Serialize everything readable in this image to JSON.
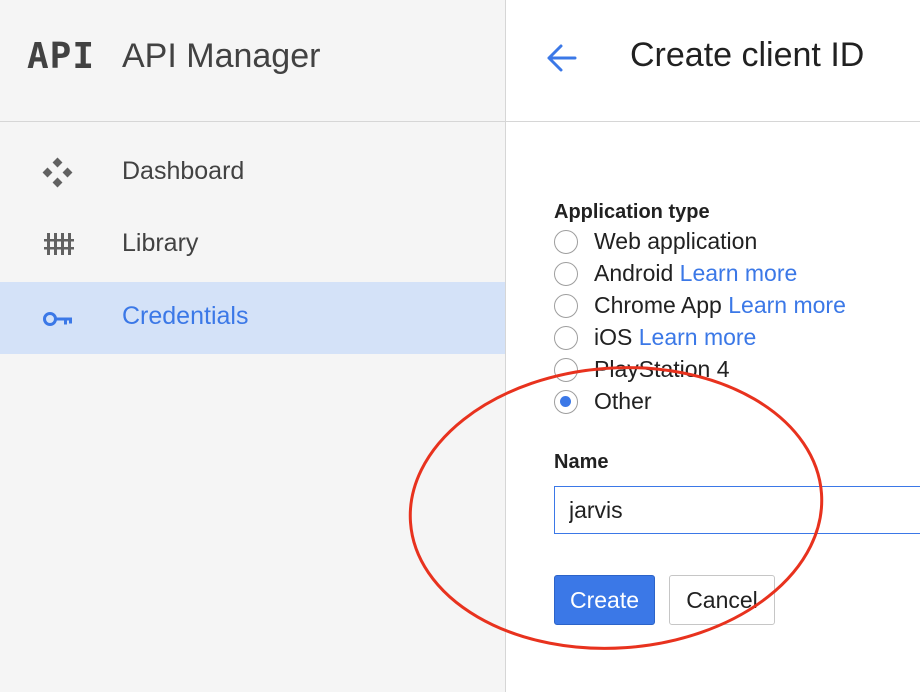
{
  "sidebar": {
    "logo": "API",
    "title": "API Manager",
    "items": [
      {
        "label": "Dashboard",
        "icon": "dashboard-icon",
        "active": false
      },
      {
        "label": "Library",
        "icon": "library-icon",
        "active": false
      },
      {
        "label": "Credentials",
        "icon": "key-icon",
        "active": true
      }
    ]
  },
  "header": {
    "back_icon": "arrow-back-icon",
    "title": "Create client ID"
  },
  "form": {
    "application_type_label": "Application type",
    "options": [
      {
        "label": "Web application",
        "link": "",
        "checked": false
      },
      {
        "label": "Android",
        "link": "Learn more",
        "checked": false
      },
      {
        "label": "Chrome App",
        "link": "Learn more",
        "checked": false
      },
      {
        "label": "iOS",
        "link": "Learn more",
        "checked": false
      },
      {
        "label": "PlayStation 4",
        "link": "",
        "checked": false
      },
      {
        "label": "Other",
        "link": "",
        "checked": true
      }
    ],
    "name_label": "Name",
    "name_value": "jarvis",
    "create_label": "Create",
    "cancel_label": "Cancel"
  },
  "colors": {
    "accent": "#3b78e7",
    "active_bg": "#d4e2f8",
    "annotation": "#e8321e"
  }
}
